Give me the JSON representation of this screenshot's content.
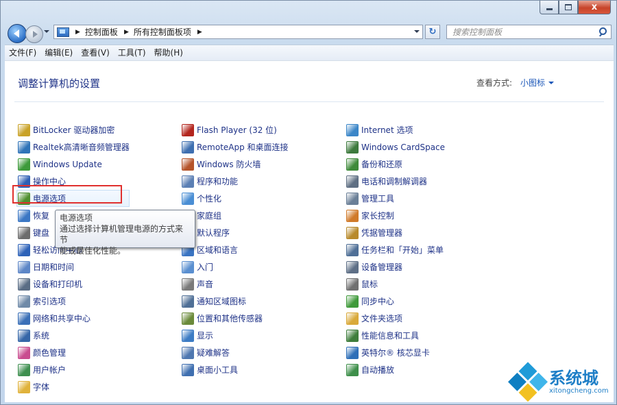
{
  "window": {
    "close_glyph": "x"
  },
  "address": {
    "crumbs": [
      "控制面板",
      "所有控制面板项"
    ]
  },
  "search": {
    "placeholder": "搜索控制面板"
  },
  "menu": [
    "文件(F)",
    "编辑(E)",
    "查看(V)",
    "工具(T)",
    "帮助(H)"
  ],
  "header": {
    "title": "调整计算机的设置",
    "view_label": "查看方式:",
    "view_value": "小图标"
  },
  "columns": [
    [
      {
        "label": "BitLocker 驱动器加密",
        "icon": "bitlocker-icon",
        "color": "#c9a227"
      },
      {
        "label": "Realtek高清晰音频管理器",
        "icon": "realtek-audio-icon",
        "color": "#2f73b8"
      },
      {
        "label": "Windows Update",
        "icon": "windows-update-icon",
        "color": "#3d9a3a"
      },
      {
        "label": "操作中心",
        "icon": "action-center-flag-icon",
        "color": "#2e5fb4"
      },
      {
        "label": "电源选项",
        "icon": "power-options-icon",
        "color": "#4f8f2f"
      },
      {
        "label": "恢复",
        "icon": "recovery-icon",
        "color": "#3b77c4"
      },
      {
        "label": "键盘",
        "icon": "keyboard-icon",
        "color": "#6d6d6d"
      },
      {
        "label": "轻松访问中心",
        "icon": "ease-of-access-icon",
        "color": "#2d62b8"
      },
      {
        "label": "日期和时间",
        "icon": "date-time-icon",
        "color": "#5d86c7"
      },
      {
        "label": "设备和打印机",
        "icon": "devices-printers-icon",
        "color": "#5a6d85"
      },
      {
        "label": "索引选项",
        "icon": "indexing-options-icon",
        "color": "#6f8aa8"
      },
      {
        "label": "网络和共享中心",
        "icon": "network-sharing-icon",
        "color": "#3a6fb7"
      },
      {
        "label": "系统",
        "icon": "system-icon",
        "color": "#3566a8"
      },
      {
        "label": "颜色管理",
        "icon": "color-management-icon",
        "color": "#c94c8f"
      },
      {
        "label": "用户帐户",
        "icon": "user-accounts-icon",
        "color": "#3e8f4f"
      },
      {
        "label": "字体",
        "icon": "fonts-folder-icon",
        "color": "#e0b23b"
      }
    ],
    [
      {
        "label": "Flash Player (32 位)",
        "icon": "flash-player-icon",
        "color": "#b3261e"
      },
      {
        "label": "RemoteApp 和桌面连接",
        "icon": "remoteapp-icon",
        "color": "#3e6fb0"
      },
      {
        "label": "Windows 防火墙",
        "icon": "firewall-icon",
        "color": "#b5542a"
      },
      {
        "label": "程序和功能",
        "icon": "programs-features-icon",
        "color": "#5b7fb4"
      },
      {
        "label": "个性化",
        "icon": "personalization-icon",
        "color": "#4a8ed4"
      },
      {
        "label": "家庭组",
        "icon": "homegroup-icon",
        "color": "#3a8ad0"
      },
      {
        "label": "默认程序",
        "icon": "default-programs-icon",
        "color": "#4a9a3c"
      },
      {
        "label": "区域和语言",
        "icon": "region-language-icon",
        "color": "#3a74c2"
      },
      {
        "label": "入门",
        "icon": "getting-started-icon",
        "color": "#5a8fd0"
      },
      {
        "label": "声音",
        "icon": "sound-icon",
        "color": "#7a7a7a"
      },
      {
        "label": "通知区域图标",
        "icon": "notification-area-icon",
        "color": "#4f6f96"
      },
      {
        "label": "位置和其他传感器",
        "icon": "location-sensors-icon",
        "color": "#6a8a3a"
      },
      {
        "label": "显示",
        "icon": "display-icon",
        "color": "#3d7cc4"
      },
      {
        "label": "疑难解答",
        "icon": "troubleshooting-icon",
        "color": "#4f77b0"
      },
      {
        "label": "桌面小工具",
        "icon": "desktop-gadgets-icon",
        "color": "#3f6fb0"
      }
    ],
    [
      {
        "label": "Internet 选项",
        "icon": "internet-options-icon",
        "color": "#3b86c8"
      },
      {
        "label": "Windows CardSpace",
        "icon": "cardspace-icon",
        "color": "#3d7a3d"
      },
      {
        "label": "备份和还原",
        "icon": "backup-restore-icon",
        "color": "#3f8a3a"
      },
      {
        "label": "电话和调制解调器",
        "icon": "phone-modem-icon",
        "color": "#5f6f83"
      },
      {
        "label": "管理工具",
        "icon": "admin-tools-icon",
        "color": "#6a7f97"
      },
      {
        "label": "家长控制",
        "icon": "parental-controls-icon",
        "color": "#d07a2a"
      },
      {
        "label": "凭据管理器",
        "icon": "credential-manager-icon",
        "color": "#b88a2c"
      },
      {
        "label": "任务栏和「开始」菜单",
        "icon": "taskbar-start-icon",
        "color": "#4f6f96"
      },
      {
        "label": "设备管理器",
        "icon": "device-manager-icon",
        "color": "#5e6f86"
      },
      {
        "label": "鼠标",
        "icon": "mouse-icon",
        "color": "#707070"
      },
      {
        "label": "同步中心",
        "icon": "sync-center-icon",
        "color": "#3f9a3a"
      },
      {
        "label": "文件夹选项",
        "icon": "folder-options-icon",
        "color": "#d9a93a"
      },
      {
        "label": "性能信息和工具",
        "icon": "performance-tools-icon",
        "color": "#3e7d3c"
      },
      {
        "label": "英特尔® 核芯显卡",
        "icon": "intel-graphics-icon",
        "color": "#2e6fb8"
      },
      {
        "label": "自动播放",
        "icon": "autoplay-icon",
        "color": "#3e8f4a"
      }
    ]
  ],
  "tooltip": {
    "title": "电源选项",
    "line1": "通过选择计算机管理电源的方式来节",
    "line2": "能或最佳化性能。"
  },
  "watermark": {
    "brand": "系统城",
    "domain": "xitongcheng.com"
  }
}
